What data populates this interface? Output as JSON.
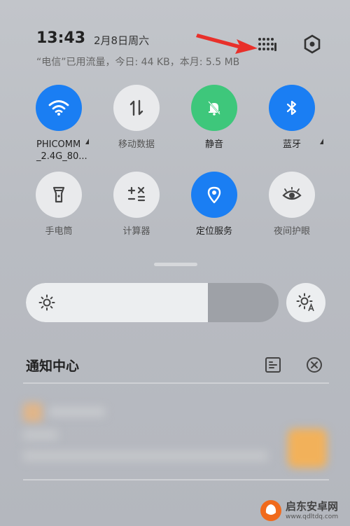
{
  "status": {
    "time": "13:43",
    "date": "2月8日周六",
    "data_usage": "“电信”已用流量，今日: 44 KB，本月: 5.5 MB"
  },
  "tiles": [
    {
      "label_line1": "PHICOMM",
      "label_line2": "_2.4G_80...",
      "icon": "wifi-icon",
      "active": true
    },
    {
      "label_line1": "移动数据",
      "icon": "mobile-data-icon",
      "active": false
    },
    {
      "label_line1": "静音",
      "icon": "silent-bell-icon",
      "active": true
    },
    {
      "label_line1": "蓝牙",
      "icon": "bluetooth-icon",
      "active": true
    },
    {
      "label_line1": "手电筒",
      "icon": "flashlight-icon",
      "active": false
    },
    {
      "label_line1": "计算器",
      "icon": "calculator-icon",
      "active": false
    },
    {
      "label_line1": "定位服务",
      "icon": "location-icon",
      "active": true
    },
    {
      "label_line1": "夜间护眼",
      "icon": "eye-icon",
      "active": false
    }
  ],
  "brightness": {
    "level": 0.72
  },
  "notification_center": {
    "title": "通知中心"
  },
  "watermark": {
    "name": "启东安卓网",
    "url": "www.qdltdq.com"
  },
  "colors": {
    "accent_blue": "#1a7ef3",
    "accent_green": "#3ec77b",
    "arrow_red": "#e8302a"
  }
}
